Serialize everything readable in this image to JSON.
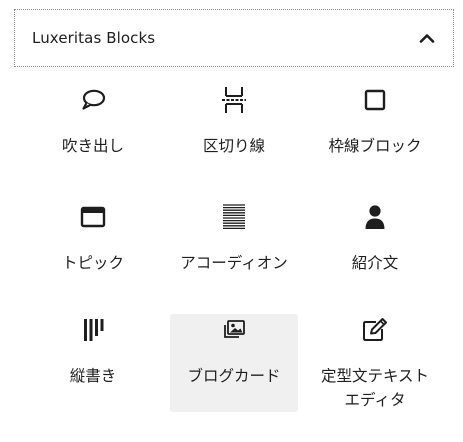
{
  "panel": {
    "title": "Luxeritas Blocks",
    "expanded": true
  },
  "blocks": [
    {
      "label": "吹き出し",
      "icon": "speech-bubble-icon"
    },
    {
      "label": "区切り線",
      "icon": "separator-icon"
    },
    {
      "label": "枠線ブロック",
      "icon": "bordered-square-icon"
    },
    {
      "label": "トピック",
      "icon": "topic-window-icon"
    },
    {
      "label": "アコーディオン",
      "icon": "accordion-lines-icon"
    },
    {
      "label": "紹介文",
      "icon": "person-icon"
    },
    {
      "label": "縦書き",
      "icon": "vertical-writing-icon"
    },
    {
      "label": "ブログカード",
      "icon": "blog-card-images-icon"
    },
    {
      "label": "定型文テキスト\nエディタ",
      "icon": "edit-pencil-square-icon"
    }
  ],
  "selected_index": 7,
  "colors": {
    "text": "#1e1e1e",
    "selected_background": "#f0f0f1",
    "border": "#8c8c8c"
  }
}
